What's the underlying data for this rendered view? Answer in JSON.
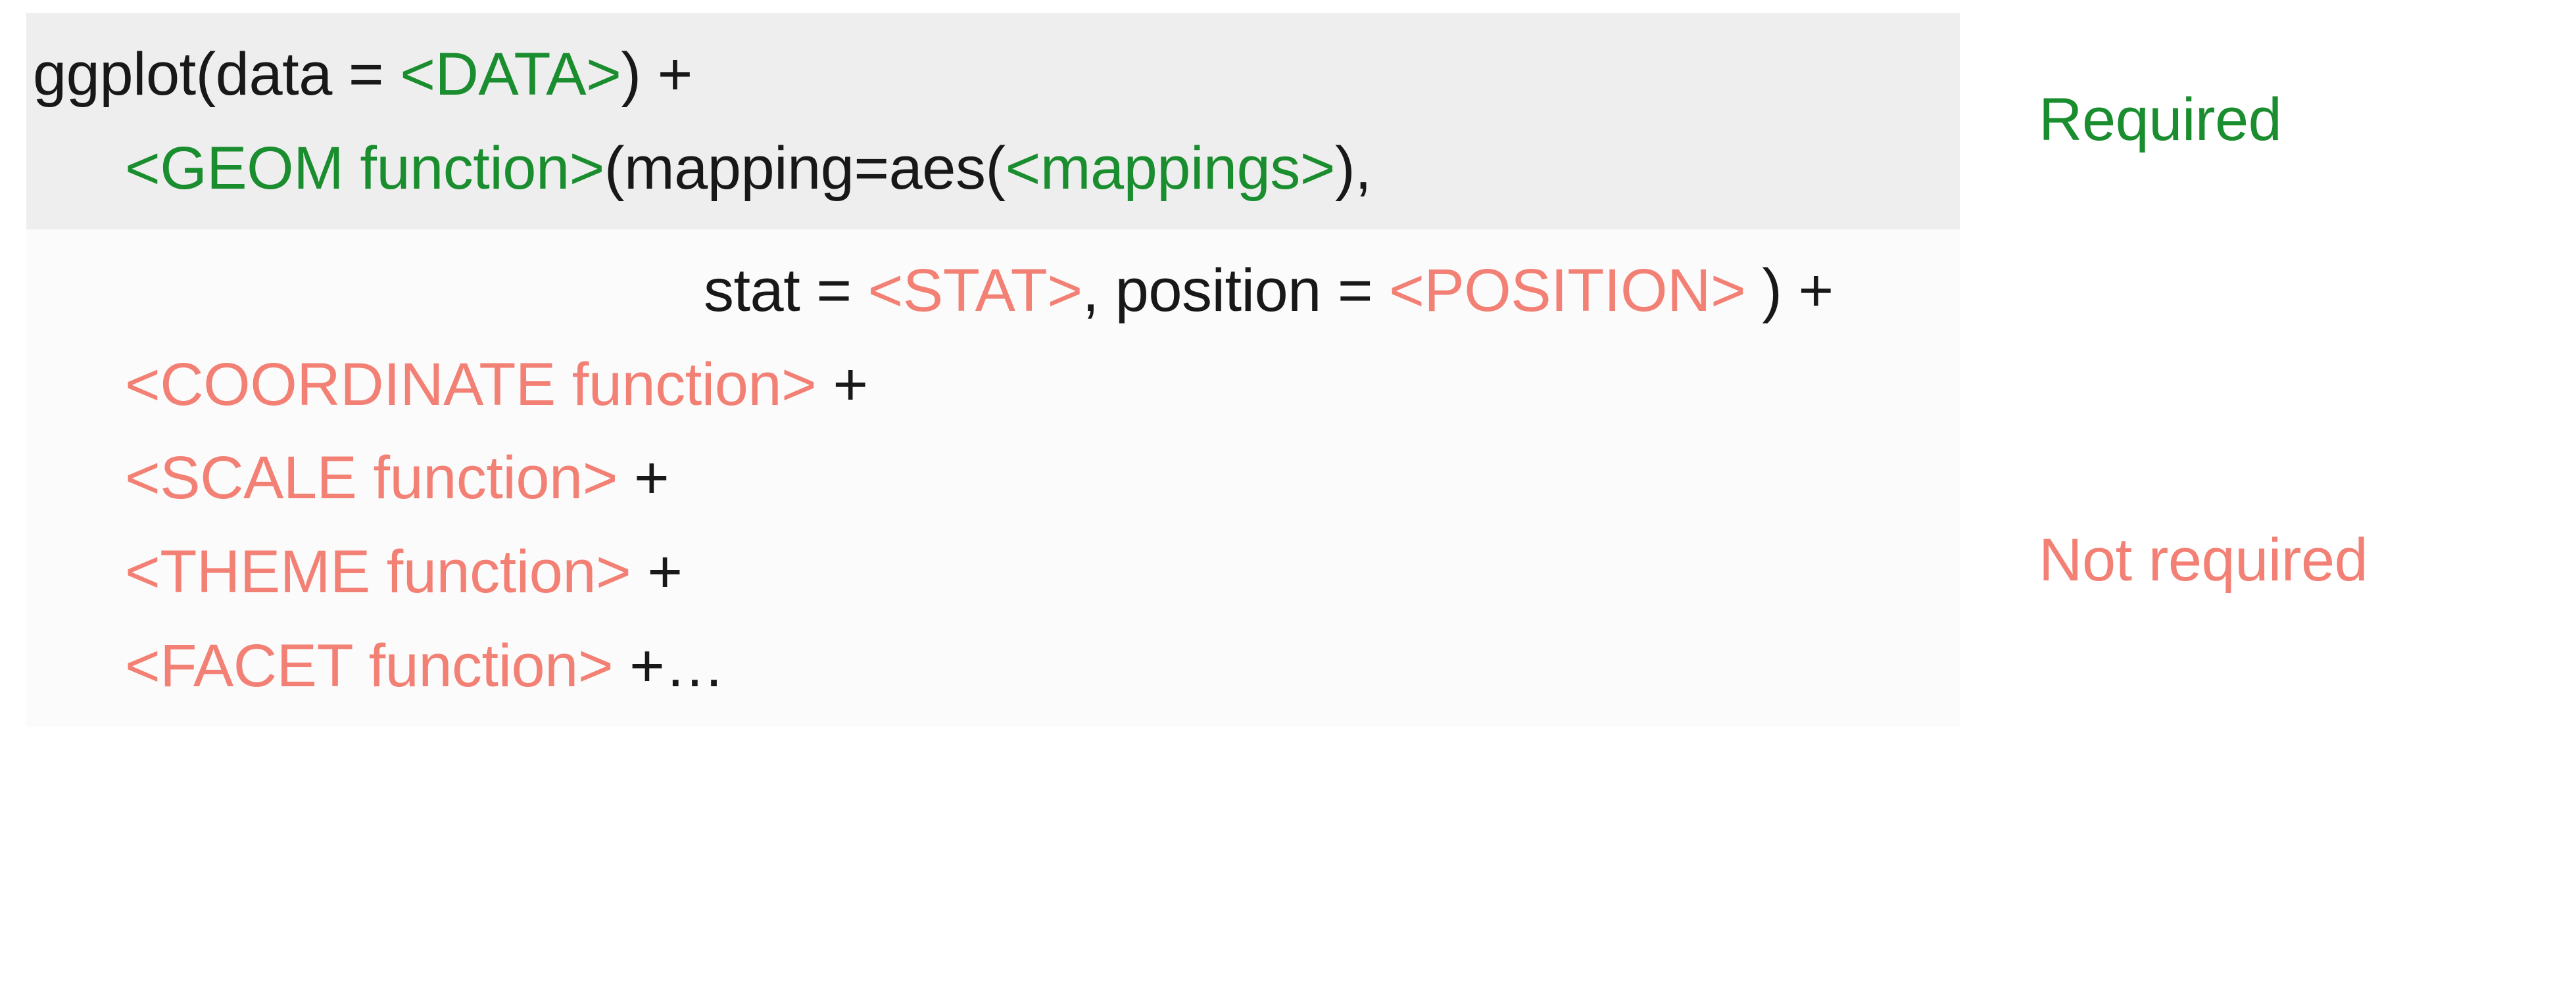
{
  "code": {
    "line1_a": "ggplot(data = ",
    "line1_b": "<DATA>",
    "line1_c": ") +",
    "line2_a": "<GEOM function>",
    "line2_b": "(mapping=aes(",
    "line2_c": "<mappings>",
    "line2_d": "),",
    "line3_a": "stat = ",
    "line3_b": "<STAT>",
    "line3_c": ", position = ",
    "line3_d": "<POSITION>",
    "line3_e": " ) +",
    "line4_a": "<COORDINATE function>",
    "line4_b": " +",
    "line5_a": "<SCALE function>",
    "line5_b": " +",
    "line6_a": "<THEME function>",
    "line6_b": " +",
    "line7_a": "<FACET function>",
    "line7_b": " +…"
  },
  "labels": {
    "required": "Required",
    "not_required": "Not required"
  }
}
